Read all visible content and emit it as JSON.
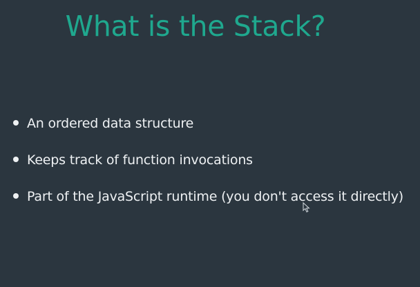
{
  "slide": {
    "title": "What is the Stack?",
    "bullets": [
      "An ordered data structure",
      "Keeps track of function invocations",
      "Part of the JavaScript runtime (you don't access it directly)"
    ]
  },
  "colors": {
    "background": "#2b363f",
    "title": "#1fa88e",
    "text": "#eef1f3"
  },
  "icons": {
    "bullet": "bullet-dot-icon",
    "pointer": "mouse-pointer-icon"
  }
}
